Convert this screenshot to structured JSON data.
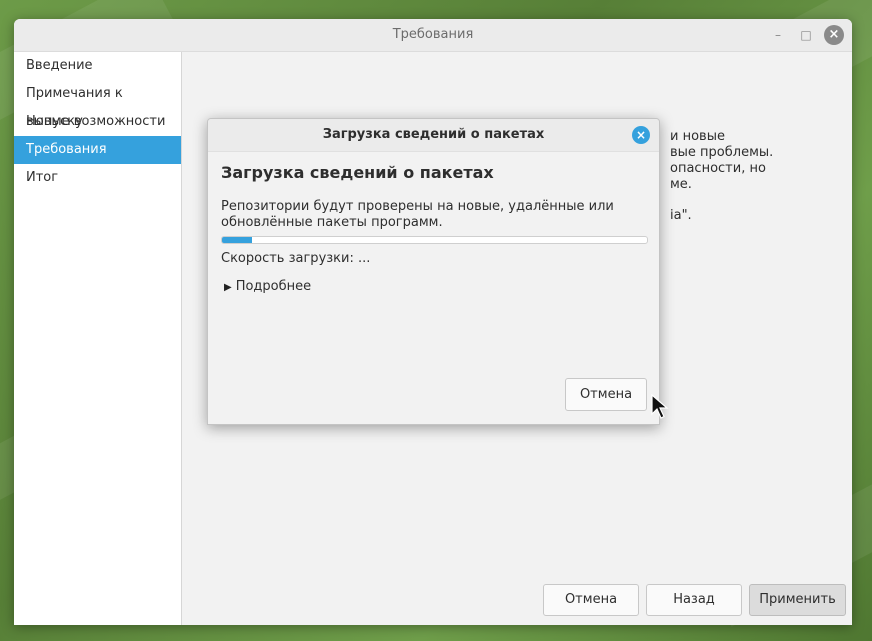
{
  "window": {
    "title": "Требования"
  },
  "sidebar": {
    "items": [
      {
        "label": "Введение",
        "active": false
      },
      {
        "label": "Примечания к выпуску",
        "active": false
      },
      {
        "label": "Новые возможности",
        "active": false
      },
      {
        "label": "Требования",
        "active": true
      },
      {
        "label": "Итог",
        "active": false
      }
    ]
  },
  "background_text": {
    "line1": "и новые",
    "line2": "вые проблемы.",
    "line3": "опасности, но",
    "line4": "ме.",
    "line5": "ia\"."
  },
  "footer": {
    "cancel_label": "Отмена",
    "back_label": "Назад",
    "apply_label": "Применить"
  },
  "dialog": {
    "title": "Загрузка сведений о пакетах",
    "heading": "Загрузка сведений о пакетах",
    "description": "Репозитории будут проверены на новые, удалённые или обновлённые пакеты программ.",
    "progress_percent": 7,
    "speed_text": "Скорость загрузки: ...",
    "details_label": "Подробнее",
    "cancel_label": "Отмена"
  },
  "colors": {
    "accent": "#35a1dd"
  }
}
